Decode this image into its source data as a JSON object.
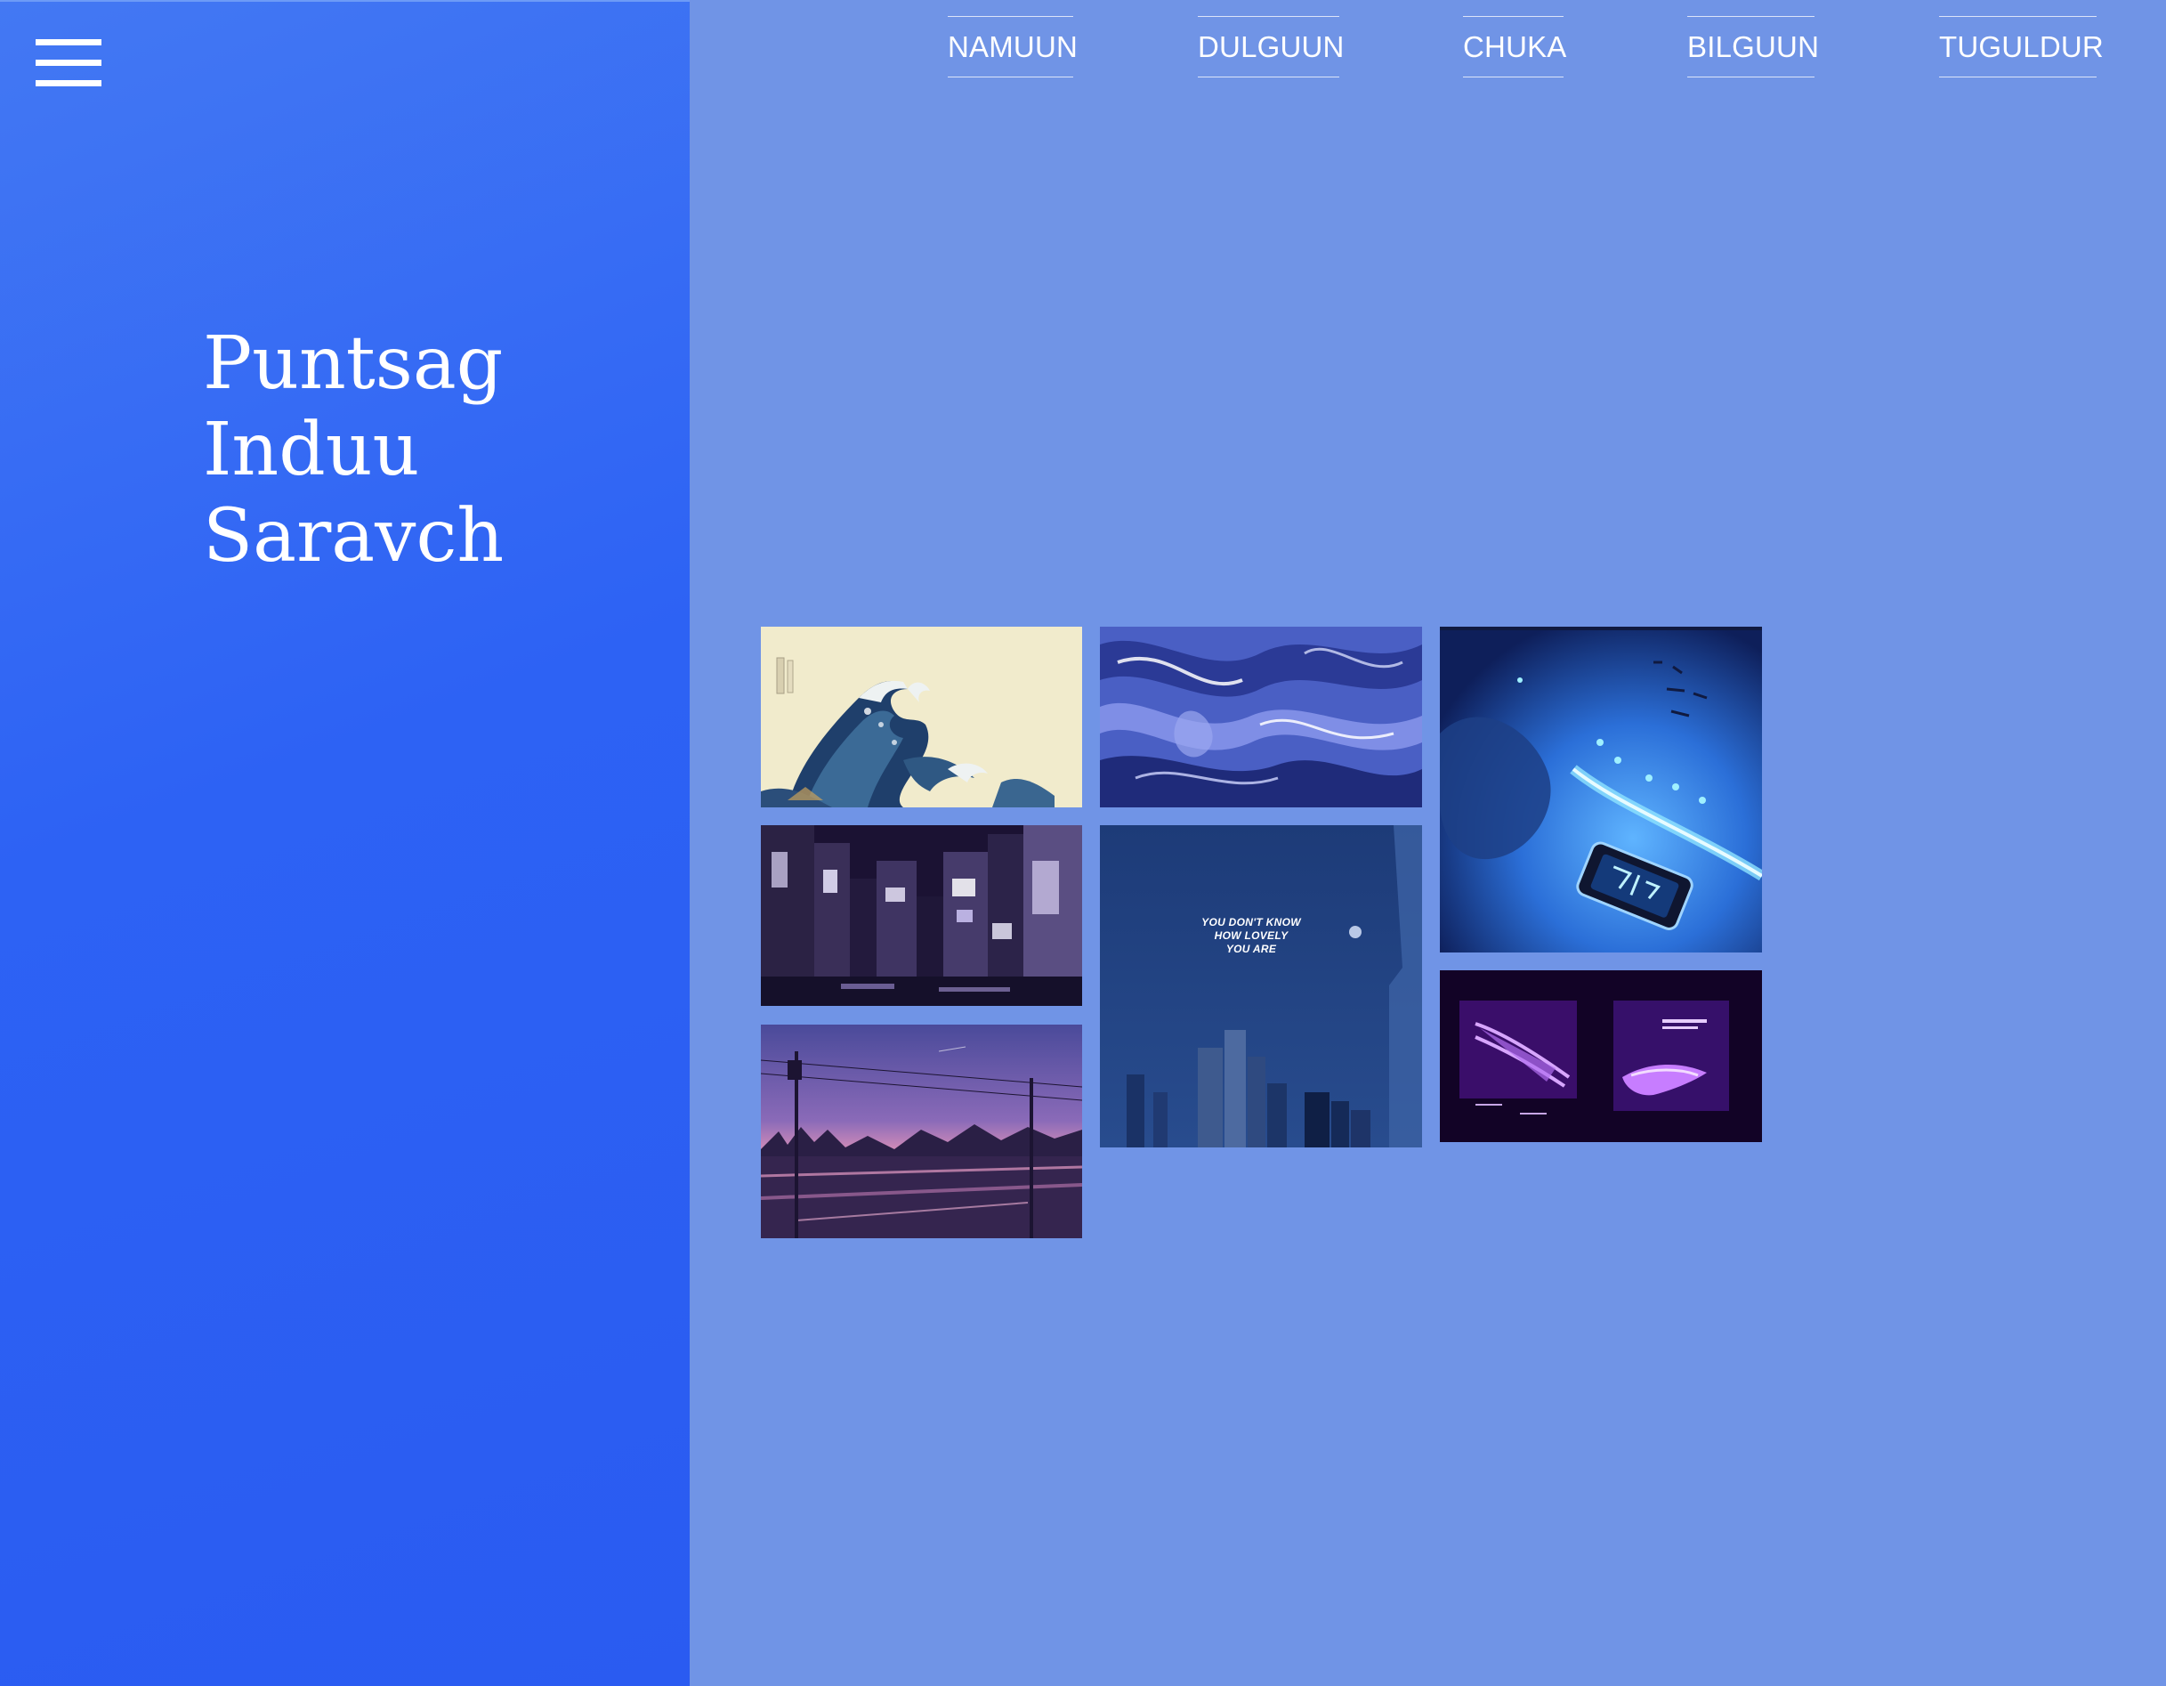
{
  "sidebar": {
    "menu_icon": "hamburger-menu-icon",
    "title_lines": [
      "Puntsag",
      "Induu",
      "Saravch"
    ]
  },
  "nav": {
    "links": [
      "NAMUUN",
      "DULGUUN",
      "CHUKA",
      "BILGUUN",
      "TUGULDUR"
    ]
  },
  "gallery": {
    "lovely_text": [
      "YOU DON'T KNOW",
      "HOW LOVELY",
      "YOU ARE"
    ]
  },
  "colors": {
    "sidebar": "#2d62f4",
    "background": "#7094e6",
    "text": "#ffffff"
  }
}
